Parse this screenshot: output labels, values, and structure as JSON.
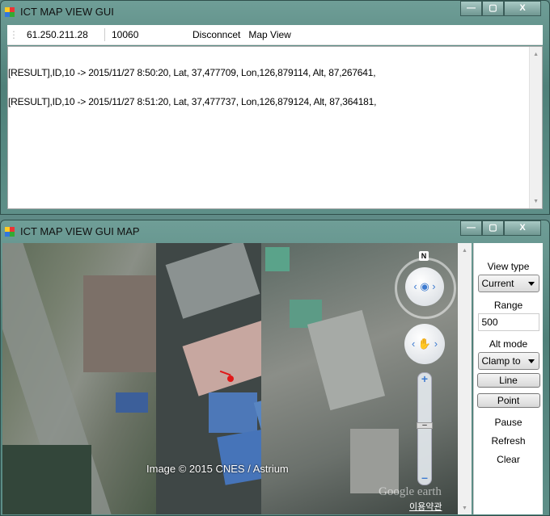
{
  "main_window": {
    "title": "ICT MAP VIEW GUI",
    "controls": {
      "minimize": "—",
      "maximize": "▢",
      "close": "X"
    },
    "toolbar": {
      "ip": "61.250.211.28",
      "port": "10060",
      "disconnect": "Disconncet",
      "map_view": "Map View"
    },
    "log_lines": [
      "[RESULT],ID,10 -> 2015/11/27 8:50:20, Lat, 37,477709, Lon,126,879114, Alt, 87,267641,",
      "[RESULT],ID,10 -> 2015/11/27 8:51:20, Lat, 37,477737, Lon,126,879124, Alt, 87,364181,"
    ]
  },
  "map_window": {
    "title": "ICT MAP VIEW GUI MAP",
    "controls": {
      "minimize": "—",
      "maximize": "▢",
      "close": "X"
    },
    "map": {
      "attribution": "Image © 2015 CNES / Astrium",
      "logo": "Google earth",
      "terms": "이용약관",
      "compass_label": "N",
      "icons": [
        "look-eye-icon",
        "move-hand-icon",
        "zoom-in-icon",
        "zoom-out-icon"
      ],
      "marker_color": "#e01818"
    },
    "panel": {
      "view_type_label": "View type",
      "view_type_value": "Current",
      "range_label": "Range",
      "range_value": "500",
      "alt_mode_label": "Alt mode",
      "alt_mode_value": "Clamp to",
      "line": "Line",
      "point": "Point",
      "pause": "Pause",
      "refresh": "Refresh",
      "clear": "Clear"
    }
  }
}
